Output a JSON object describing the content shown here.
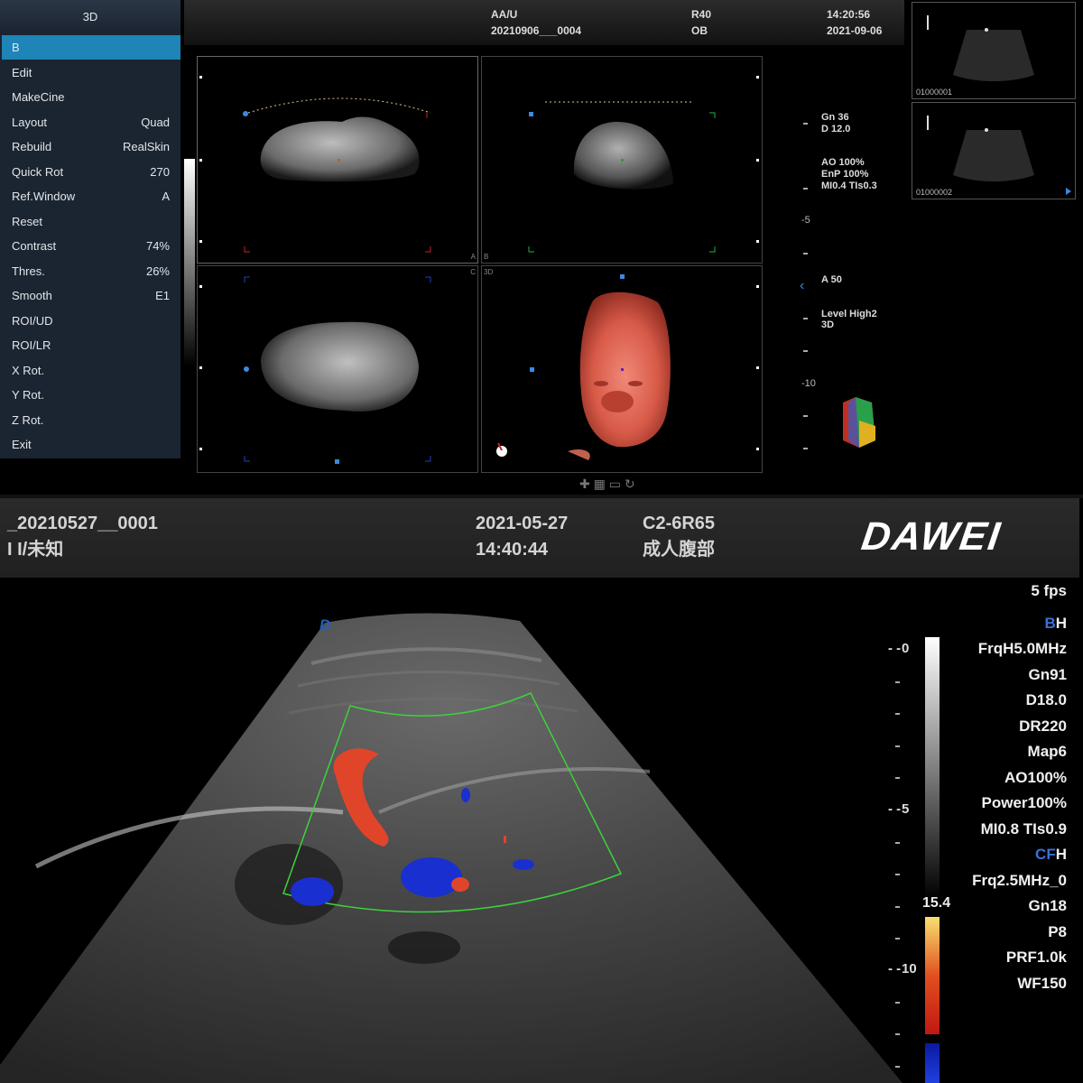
{
  "top_screen": {
    "menu": {
      "title": "3D",
      "items": [
        {
          "label": "B",
          "value": "",
          "selected": true
        },
        {
          "label": "Edit",
          "value": ""
        },
        {
          "label": "MakeCine",
          "value": ""
        },
        {
          "label": "Layout",
          "value": "Quad"
        },
        {
          "label": "Rebuild",
          "value": "RealSkin"
        },
        {
          "label": "Quick Rot",
          "value": "270"
        },
        {
          "label": "Ref.Window",
          "value": "A"
        },
        {
          "label": "Reset",
          "value": ""
        },
        {
          "label": "Contrast",
          "value": "74%"
        },
        {
          "label": "Thres.",
          "value": "26%"
        },
        {
          "label": "Smooth",
          "value": "E1"
        },
        {
          "label": "ROI/UD",
          "value": ""
        },
        {
          "label": "ROI/LR",
          "value": ""
        },
        {
          "label": "X Rot.",
          "value": ""
        },
        {
          "label": "Y Rot.",
          "value": ""
        },
        {
          "label": "Z Rot.",
          "value": ""
        },
        {
          "label": "Exit",
          "value": ""
        }
      ]
    },
    "header": {
      "patient": "AA/U",
      "study_id": "20210906___0004",
      "probe": "R40",
      "exam": "OB",
      "time": "14:20:56",
      "date": "2021-09-06"
    },
    "quad_labels": {
      "a": "A",
      "b": "B",
      "c": "C",
      "d": "3D"
    },
    "params": {
      "gn": "Gn  36",
      "d": "D   12.0",
      "ao": "AO  100%",
      "enp": "EnP 100%",
      "mi": "MI0.4 TIs0.3",
      "depth5": "-5",
      "a50": "A  50",
      "level": "Level High2",
      "mode3d": "3D",
      "depth10": "-10"
    },
    "thumbnails": [
      {
        "label": "01000001"
      },
      {
        "label": "01000002"
      }
    ]
  },
  "bottom_screen": {
    "patient_id": "_20210527__0001",
    "patient_name": "I I/未知",
    "date": "2021-05-27",
    "time": "14:40:44",
    "probe": "C2-6R65",
    "preset": "成人腹部",
    "logo": "DAWEI",
    "fps": "5 fps",
    "b_mode": "BH",
    "b_params": [
      "FrqH5.0MHz",
      "Gn91",
      "D18.0",
      "DR220",
      "Map6",
      "AO100%",
      "Power100%",
      "MI0.8 TIs0.9"
    ],
    "cf_mode": "CFH",
    "cf_params": [
      "Frq2.5MHz_0",
      "Gn18",
      "P8",
      "PRF1.0k",
      "WF150"
    ],
    "color_scale_max": "15.4",
    "depth_0": "0",
    "depth_5": "5",
    "depth_10": "10",
    "orientation_mark": "D"
  },
  "colors": {
    "menu_bg": "#1b2431",
    "menu_selected": "#1f84b8",
    "doppler_red": "#e0452a",
    "doppler_blue": "#1a2fd0",
    "roi_box": "#3cd23c",
    "mode_blue": "#3a70d8"
  }
}
